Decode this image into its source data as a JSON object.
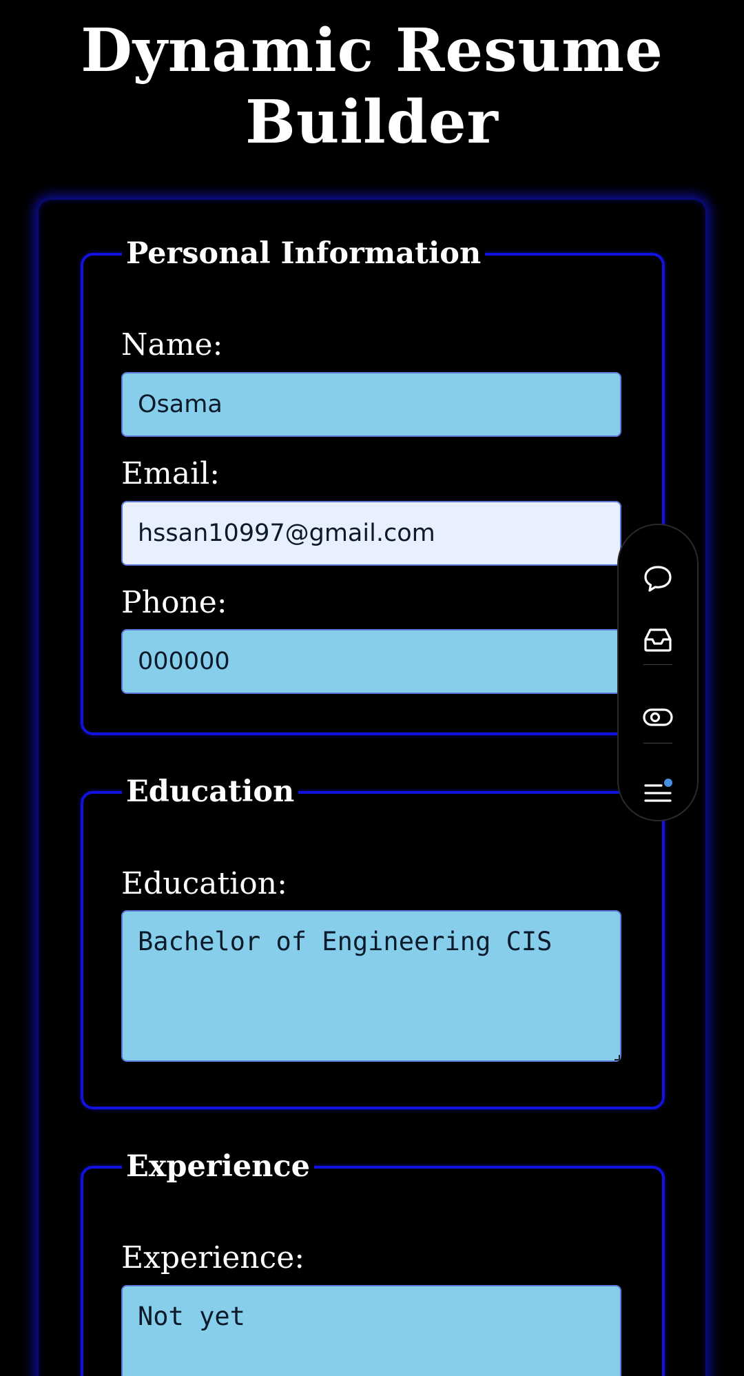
{
  "page": {
    "title_line1": "Dynamic Resume",
    "title_line2": "Builder"
  },
  "personal": {
    "legend": "Personal Information",
    "name_label": "Name:",
    "name_value": "Osama",
    "email_label": "Email:",
    "email_value": "hssan10997@gmail.com",
    "phone_label": "Phone:",
    "phone_value": "000000"
  },
  "education": {
    "legend": "Education",
    "label": "Education:",
    "value": "Bachelor of Engineering CIS"
  },
  "experience": {
    "legend": "Experience",
    "label": "Experience:",
    "value": "Not yet"
  },
  "floating_toolbar": {
    "icons": [
      "chat-bubble-icon",
      "inbox-tray-icon",
      "toggle-eye-icon",
      "menu-notification-icon"
    ],
    "notification_dot_color": "#4a90e2"
  },
  "colors": {
    "accent_border": "#1212e0",
    "input_background": "#87ceeb",
    "focused_input_background": "#e8effd",
    "page_background": "#000000"
  }
}
